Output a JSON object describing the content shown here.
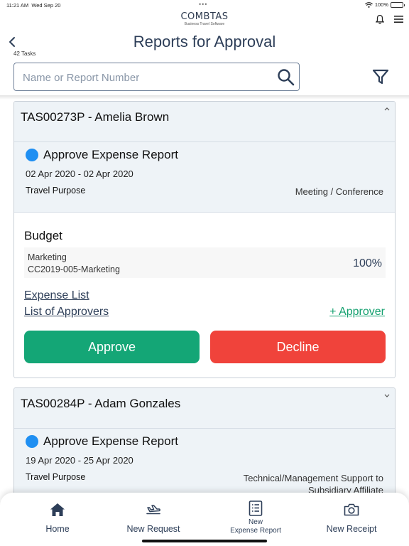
{
  "status_bar": {
    "time": "11:21 AM",
    "date": "Wed Sep 20",
    "battery": "100%",
    "battery_level": 1.0
  },
  "logo": {
    "main": "COMBTAS",
    "sub": "Business Travel Software"
  },
  "header": {
    "title": "Reports for Approval",
    "task_count": "42 Tasks"
  },
  "search": {
    "placeholder": "Name or Report Number",
    "value": ""
  },
  "reports": [
    {
      "title": "TAS00273P - Amelia Brown",
      "expanded": true,
      "status": "Approve Expense Report",
      "status_color": "#1f8ff2",
      "date_range": "02 Apr 2020 - 02 Apr 2020",
      "purpose_label": "Travel Purpose",
      "purpose_value": "Meeting / Conference",
      "budget_title": "Budget",
      "budget": {
        "department": "Marketing",
        "code": "CC2019-005-Marketing",
        "percent": "100%"
      },
      "links": {
        "expense_list": "Expense List",
        "approvers": "List of Approvers",
        "add_approver": "+ Approver"
      },
      "actions": {
        "approve": "Approve",
        "decline": "Decline"
      }
    },
    {
      "title": "TAS00284P - Adam Gonzales",
      "expanded": false,
      "status": "Approve Expense Report",
      "status_color": "#1f8ff2",
      "date_range": "19 Apr 2020 - 25 Apr 2020",
      "purpose_label": "Travel Purpose",
      "purpose_value_line1": "Technical/Management Support to",
      "purpose_value_line2": "Subsidiary Affiliate"
    }
  ],
  "tabs": [
    {
      "label": "Home",
      "icon": "home-icon"
    },
    {
      "label": "New Request",
      "icon": "airplane-icon"
    },
    {
      "label_line1": "New",
      "label_line2": "Expense Report",
      "icon": "document-list-icon"
    },
    {
      "label": "New Receipt",
      "icon": "camera-icon"
    }
  ],
  "colors": {
    "primary_text": "#2d3e58",
    "approve": "#14a676",
    "decline": "#f0433b",
    "add_approver": "#14a06f",
    "card_header_bg": "#eef3f7"
  }
}
